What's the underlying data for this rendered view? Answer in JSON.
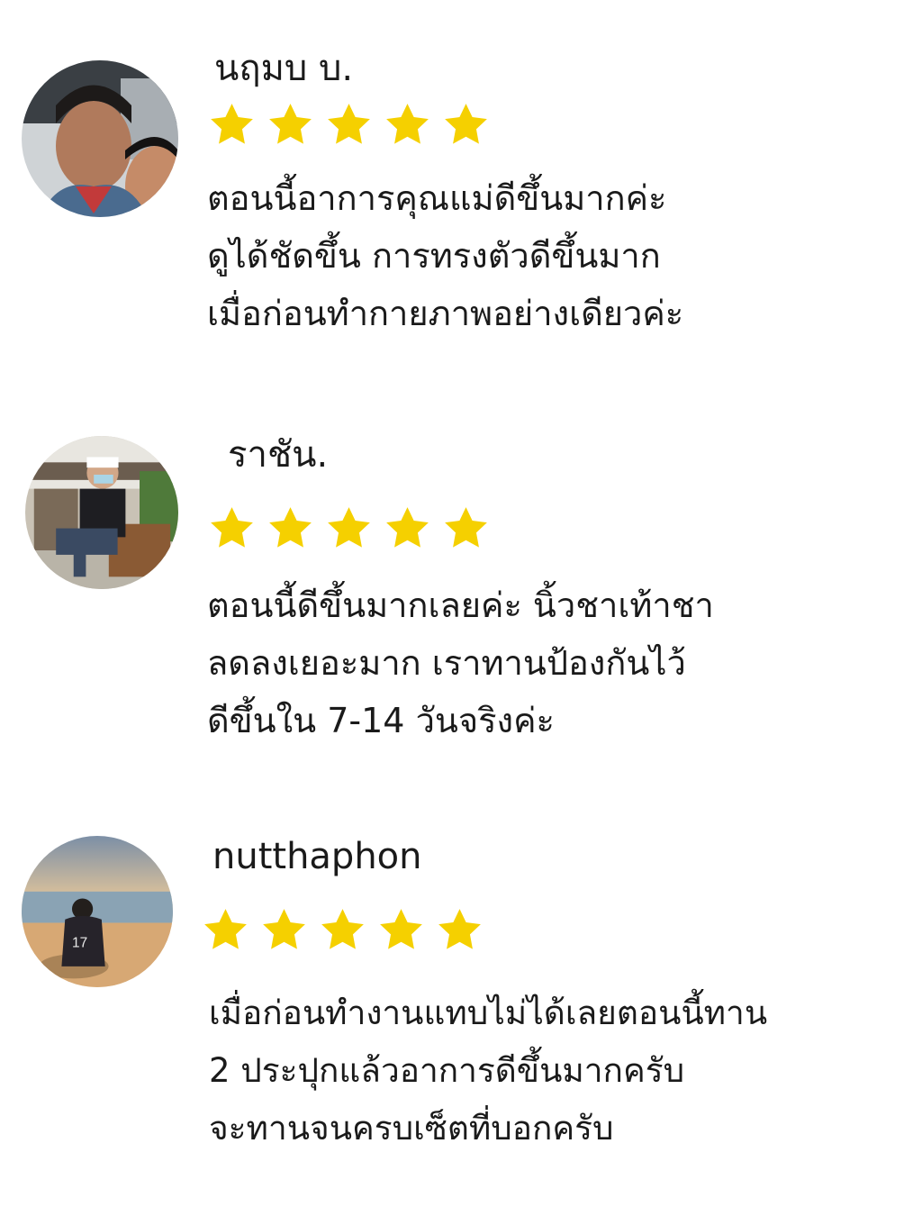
{
  "colors": {
    "star": "#F5D000",
    "text": "#1a1a1a",
    "background": "#ffffff"
  },
  "reviews": [
    {
      "name": "นฤมบ บ.",
      "rating": 5,
      "avatar_icon": "user-photo-icon",
      "lines": [
        "ตอนนี้อาการคุณแม่ดีขึ้นมากค่ะ",
        "ดูได้ชัดขึ้น การทรงตัวดีขึ้นมาก",
        "เมื่อก่อนทำกายภาพอย่างเดียวค่ะ"
      ]
    },
    {
      "name": "ราชัน.",
      "rating": 5,
      "avatar_icon": "user-photo-icon",
      "lines": [
        "ตอนนี้ดีขึ้นมากเลยค่ะ นิ้วชาเท้าชา",
        "ลดลงเยอะมาก เราทานป้องกันไว้",
        "ดีขึ้นใน 7-14 วันจริงค่ะ"
      ]
    },
    {
      "name": "nutthaphon",
      "rating": 5,
      "avatar_icon": "user-photo-icon",
      "lines": [
        "เมื่อก่อนทำงานแทบไม่ได้เลยตอนนี้ทาน",
        "2 ประปุกแล้วอาการดีขึ้นมากครับ",
        "จะทานจนครบเซ็ตที่บอกครับ"
      ]
    }
  ]
}
